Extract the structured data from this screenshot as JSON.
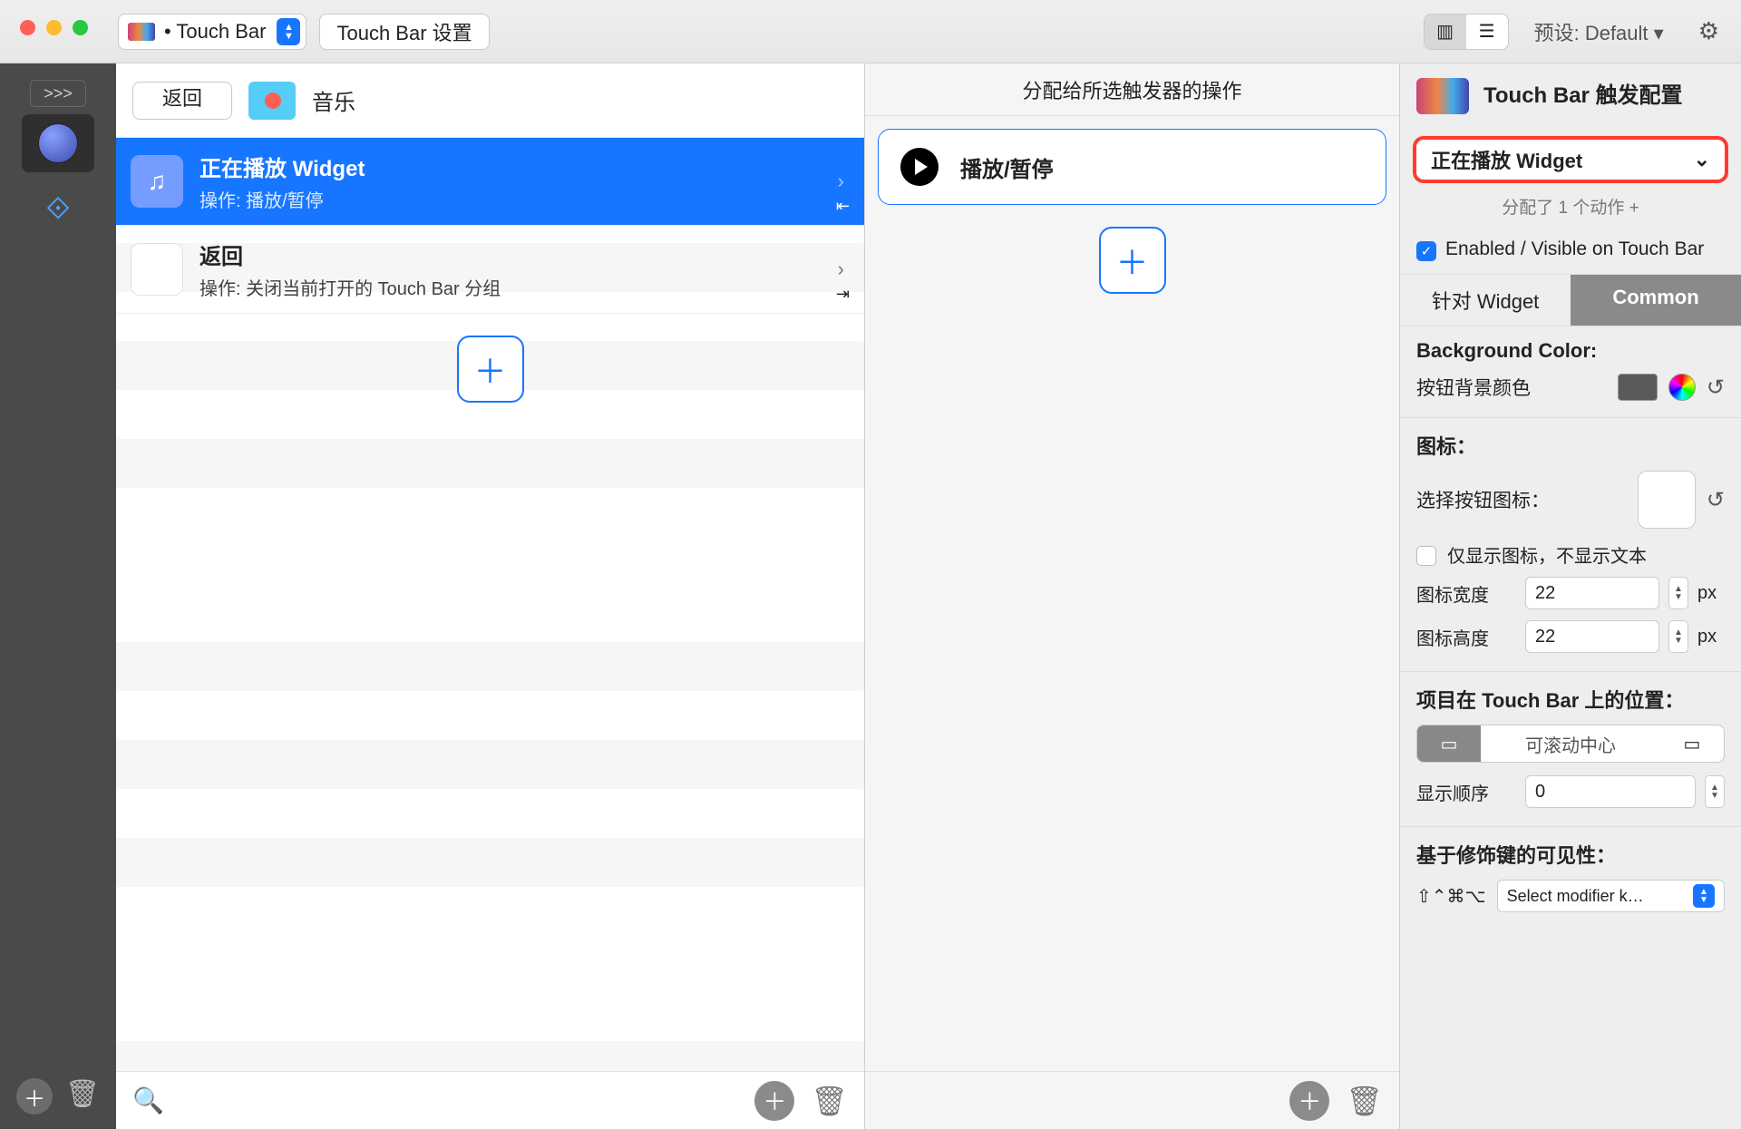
{
  "toolbar": {
    "dropdown_label": "• Touch Bar",
    "settings_button": "Touch Bar 设置",
    "preset_label": "预设: Default ▾"
  },
  "col1": {
    "back": "返回",
    "music": "音乐",
    "rows": [
      {
        "title": "正在播放 Widget",
        "sub": "操作: 播放/暂停"
      },
      {
        "title": "返回",
        "sub": "操作: 关闭当前打开的 Touch Bar 分组"
      }
    ]
  },
  "col2": {
    "header": "分配给所选触发器的操作",
    "action": "播放/暂停"
  },
  "inspector": {
    "title": "Touch Bar 触发配置",
    "widget_select": "正在播放 Widget",
    "assigned": "分配了 1 个动作 +",
    "enabled_label": "Enabled / Visible on Touch Bar",
    "tab_widget": "针对 Widget",
    "tab_common": "Common",
    "bg_title": "Background Color:",
    "bg_label": "按钮背景颜色",
    "icon_title": "图标：",
    "icon_label": "选择按钮图标：",
    "icon_only": "仅显示图标，不显示文本",
    "icon_w_label": "图标宽度",
    "icon_w": "22",
    "icon_h_label": "图标高度",
    "icon_h": "22",
    "px": "px",
    "pos_title": "项目在 Touch Bar 上的位置：",
    "pos_center": "可滚动中心",
    "order_label": "显示顺序",
    "order_value": "0",
    "mod_title": "基于修饰键的可见性：",
    "mod_sym": "⇧⌃⌘⌥",
    "mod_select": "Select modifier k…"
  }
}
